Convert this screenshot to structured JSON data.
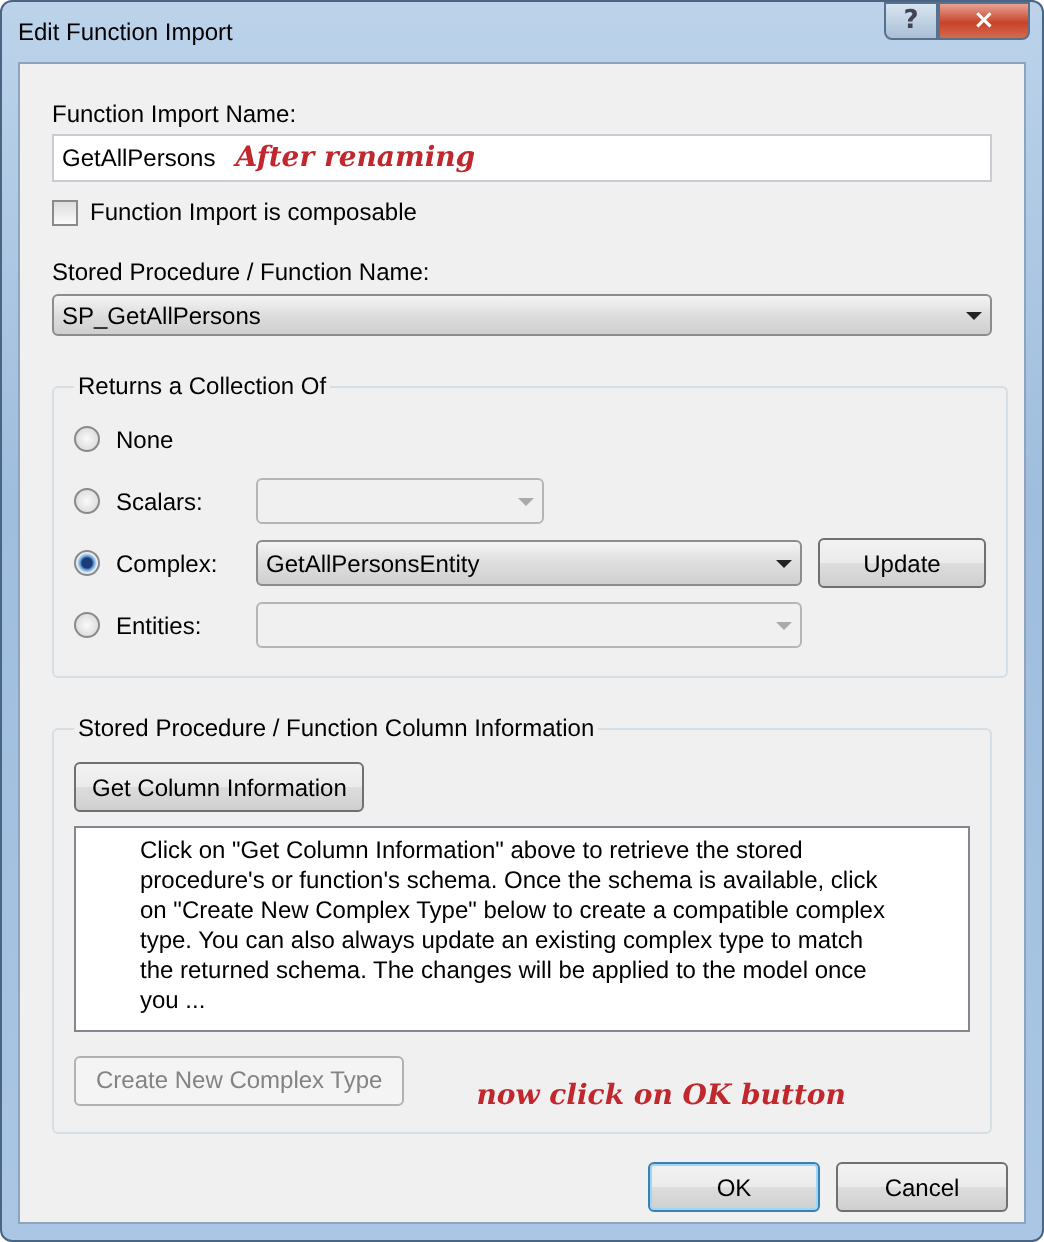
{
  "window": {
    "title": "Edit Function Import",
    "help": "?",
    "close": "×"
  },
  "name_field": {
    "label": "Function Import Name:",
    "value": "GetAllPersons",
    "annotation": "After renaming"
  },
  "composable": {
    "label": "Function Import is composable",
    "checked": false
  },
  "procedure": {
    "label": "Stored Procedure / Function Name:",
    "value": "SP_GetAllPersons"
  },
  "returns": {
    "title": "Returns a Collection Of",
    "options": [
      {
        "label": "None",
        "selected": false,
        "kind": "plain"
      },
      {
        "label": "Scalars:",
        "selected": false,
        "kind": "short-dropdown",
        "disabled": true
      },
      {
        "label": "Complex:",
        "selected": true,
        "kind": "dropdown",
        "disabled": false,
        "value": "GetAllPersonsEntity",
        "button": "Update"
      },
      {
        "label": "Entities:",
        "selected": false,
        "kind": "dropdown",
        "disabled": true
      }
    ]
  },
  "column_info": {
    "title": "Stored Procedure / Function Column Information",
    "get_button": "Get Column Information",
    "description": "Click on \"Get Column Information\" above to retrieve the stored procedure's or function's schema. Once the schema is available, click on \"Create New Complex Type\" below to create a compatible complex type. You can also always update an existing complex type to match the returned schema. The changes will be applied to the model once you ...",
    "create_button": {
      "label": "Create New Complex Type",
      "disabled": true
    },
    "annotation": "now click on OK button"
  },
  "buttons": [
    {
      "label": "OK",
      "default": true
    },
    {
      "label": "Cancel",
      "default": false
    }
  ]
}
